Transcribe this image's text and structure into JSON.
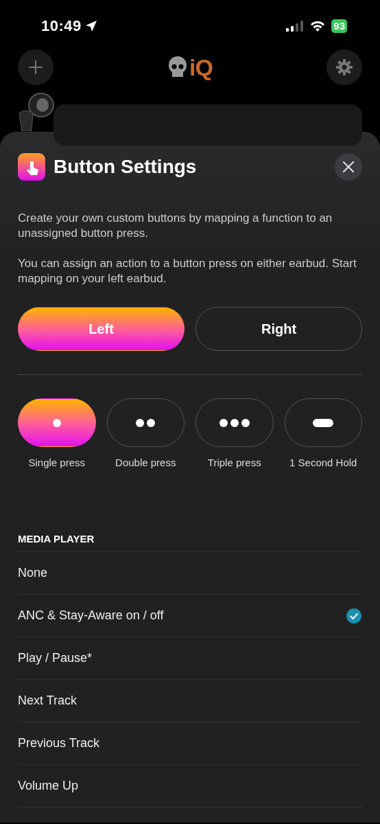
{
  "status_bar": {
    "time": "10:49",
    "battery": "93"
  },
  "header": {
    "logo_text": "iQ"
  },
  "sheet": {
    "title": "Button Settings",
    "paragraphs": [
      "Create your own custom buttons by mapping a function to an unassigned button press.",
      "You can assign an action to a button press on either earbud. Start mapping on your left earbud."
    ],
    "sides": [
      {
        "label": "Left",
        "selected": true
      },
      {
        "label": "Right",
        "selected": false
      }
    ],
    "presses": [
      {
        "label": "Single press",
        "kind": "single",
        "selected": true
      },
      {
        "label": "Double press",
        "kind": "double",
        "selected": false
      },
      {
        "label": "Triple press",
        "kind": "triple",
        "selected": false
      },
      {
        "label": "1 Second Hold",
        "kind": "hold",
        "selected": false
      }
    ],
    "section_title": "MEDIA PLAYER",
    "actions": [
      {
        "label": "None",
        "selected": false
      },
      {
        "label": "ANC & Stay-Aware on / off",
        "selected": true
      },
      {
        "label": "Play / Pause*",
        "selected": false
      },
      {
        "label": "Next Track",
        "selected": false
      },
      {
        "label": "Previous Track",
        "selected": false
      },
      {
        "label": "Volume Up",
        "selected": false
      }
    ]
  }
}
